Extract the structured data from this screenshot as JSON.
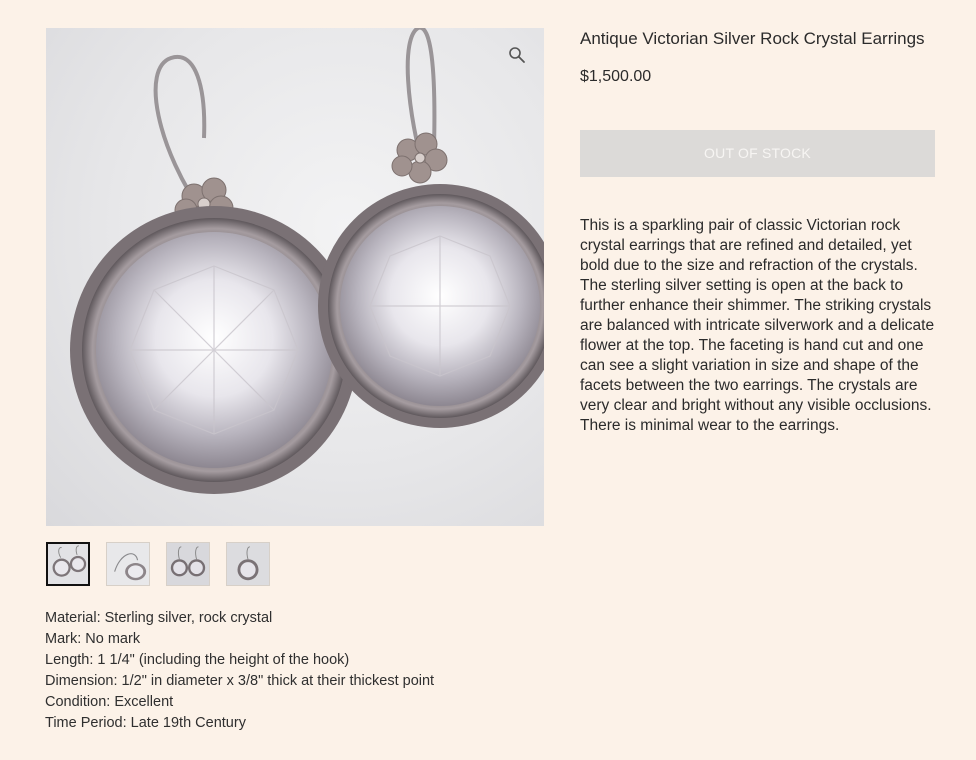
{
  "product": {
    "title": "Antique Victorian Silver Rock Crystal Earrings",
    "price": "$1,500.00",
    "stock_button_label": "OUT OF STOCK",
    "description": "This is a sparkling pair of classic Victorian rock crystal earrings that are refined and detailed, yet bold due to the size and refraction of the crystals. The sterling silver setting is open at the back to further enhance their shimmer. The striking crystals are balanced with intricate silverwork and a delicate flower at the top. The faceting is hand cut and one can see a slight variation in size and shape of the facets between the two earrings. The crystals are very clear and bright without any visible occlusions. There is minimal wear to the earrings."
  },
  "gallery": {
    "zoom_icon": "magnifier-icon",
    "thumbnail_count": 4,
    "active_thumbnail": 1
  },
  "specs": [
    "Material: Sterling silver, rock crystal",
    "Mark: No mark",
    "Length: 1 1/4\" (including the height of the hook)",
    "Dimension: 1/2\" in diameter x 3/8\" thick at their thickest point",
    "Condition: Excellent",
    "Time Period: Late 19th Century"
  ],
  "colors": {
    "background": "#fcf2e8",
    "button_disabled": "#dcdad8",
    "text": "#2b2b2b"
  }
}
